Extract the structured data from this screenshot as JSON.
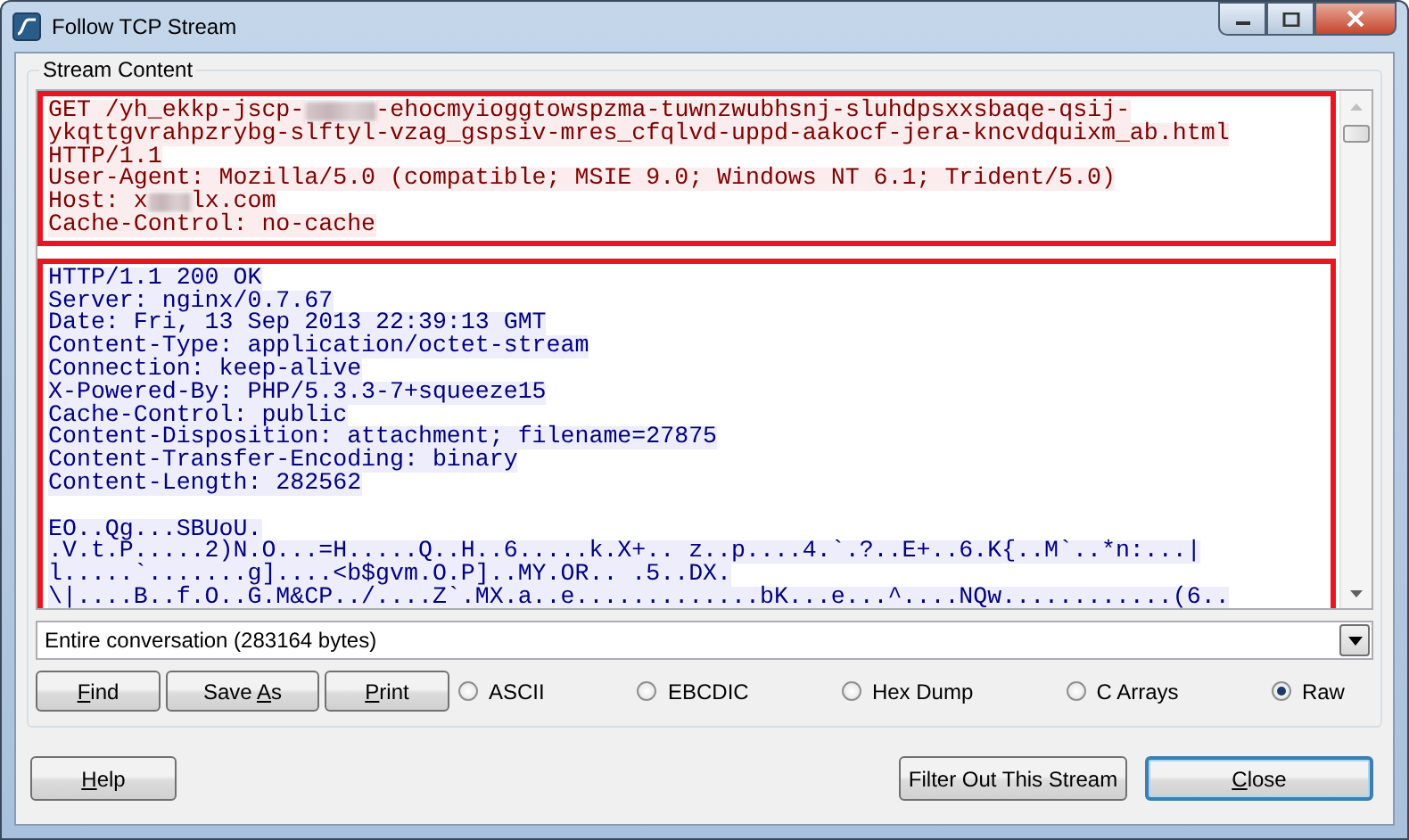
{
  "window": {
    "title": "Follow TCP Stream"
  },
  "group": {
    "label": "Stream Content"
  },
  "sections": [
    {
      "kind": "client",
      "highlighted": true,
      "lines": [
        [
          "GET /yh_ekkp-jscp-",
          "-ehocmyioggtowspzma-tuwnzwubhsnj-sluhdpsxxsbaqe-qsij-"
        ],
        [
          "ykqttgvrahpzrybg-slftyl-vzag_gspsiv-mres_cfqlvd-uppd-aakocf-jera-kncvdquixm_ab.html"
        ],
        [
          "HTTP/1.1"
        ],
        [
          "User-Agent: Mozilla/5.0 (compatible; MSIE 9.0; Windows NT 6.1; Trident/5.0)"
        ],
        [
          "Host: x",
          "lx.com"
        ],
        [
          "Cache-Control: no-cache"
        ]
      ]
    },
    {
      "kind": "server",
      "highlighted": true,
      "lines": [
        [
          "HTTP/1.1 200 OK"
        ],
        [
          "Server: nginx/0.7.67"
        ],
        [
          "Date: Fri, 13 Sep 2013 22:39:13 GMT"
        ],
        [
          "Content-Type: application/octet-stream"
        ],
        [
          "Connection: keep-alive"
        ],
        [
          "X-Powered-By: PHP/5.3.3-7+squeeze15"
        ],
        [
          "Cache-Control: public"
        ],
        [
          "Content-Disposition: attachment; filename=27875"
        ],
        [
          "Content-Transfer-Encoding: binary"
        ],
        [
          "Content-Length: 282562"
        ]
      ],
      "body_lines": [
        [
          "EO..Qg...SBUoU."
        ],
        [
          ".V.t.P.....2)N.O...=H.....Q..H..6.....k.X+.. z..p....4.`.?..E+..6.K{..M`..*n:...|"
        ],
        [
          "l.....`.......g]....<b$gvm.O.P]..MY.OR.. .5..DX."
        ],
        [
          "\\|....B..f.O..G.M&CP../....Z`.MX.a..e.............bK...e...^....NQw............(6.."
        ]
      ]
    }
  ],
  "conversation": {
    "value": "Entire conversation (283164 bytes)"
  },
  "actions": [
    {
      "label": [
        {
          "text": "F",
          "underlined": true
        },
        {
          "text": "ind",
          "underlined": false
        }
      ]
    },
    {
      "label": [
        {
          "text": "Save ",
          "underlined": false
        },
        {
          "text": "A",
          "underlined": true
        },
        {
          "text": "s",
          "underlined": false
        }
      ]
    },
    {
      "label": [
        {
          "text": "P",
          "underlined": true
        },
        {
          "text": "rint",
          "underlined": false
        }
      ]
    }
  ],
  "formats": [
    {
      "label": "ASCII",
      "selected": false
    },
    {
      "label": "EBCDIC",
      "selected": false
    },
    {
      "label": "Hex Dump",
      "selected": false
    },
    {
      "label": "C Arrays",
      "selected": false
    },
    {
      "label": "Raw",
      "selected": true
    }
  ],
  "footer_left": [
    {
      "label": [
        {
          "text": "H",
          "underlined": true
        },
        {
          "text": "elp",
          "underlined": false
        }
      ],
      "default": false
    }
  ],
  "footer_right": [
    {
      "label": [
        {
          "text": "Filter Out This Stream",
          "underlined": false
        }
      ],
      "default": false
    },
    {
      "label": [
        {
          "text": "C",
          "underlined": true
        },
        {
          "text": "lose",
          "underlined": false
        }
      ],
      "default": true
    }
  ]
}
